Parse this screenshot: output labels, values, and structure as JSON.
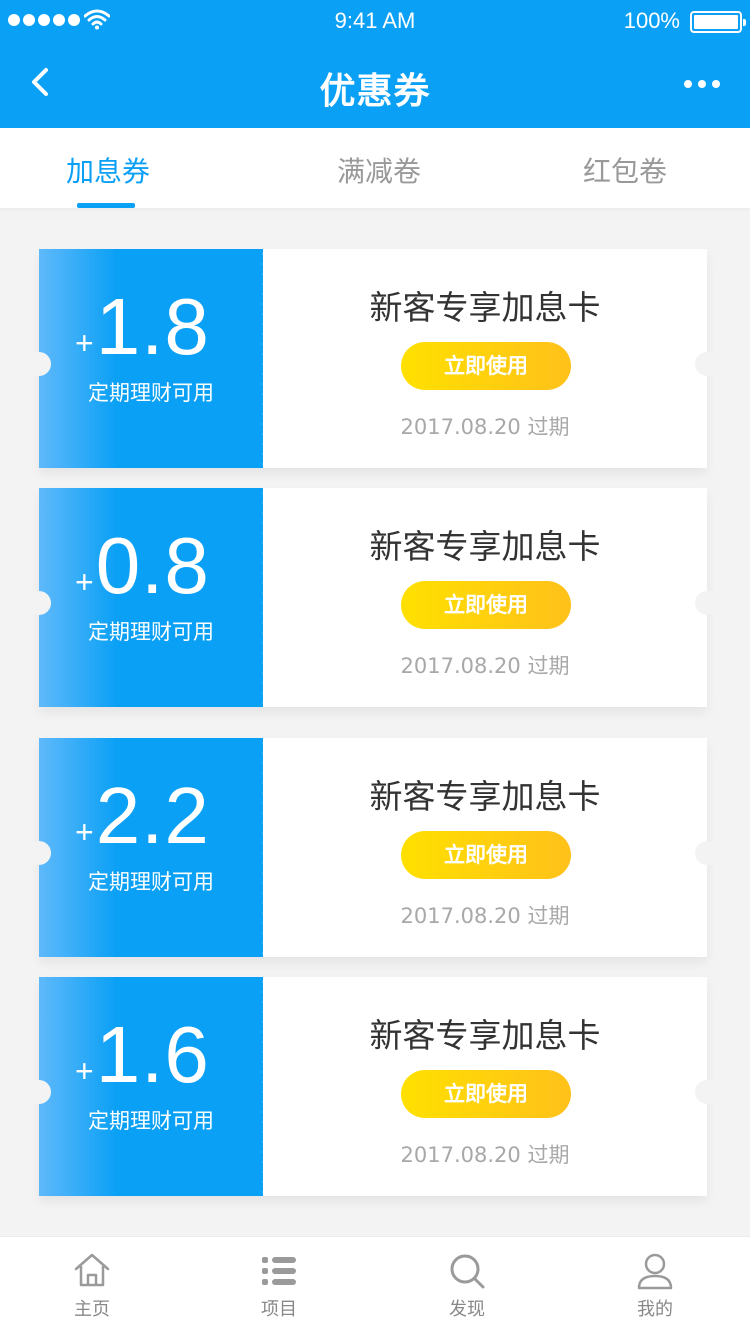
{
  "status_bar": {
    "time": "9:41 AM",
    "battery": "100%"
  },
  "nav": {
    "title": "优惠券",
    "back_icon": "chevron-left-icon",
    "more_icon": "more-dots-icon"
  },
  "tabs": [
    {
      "label": "加息券",
      "active": true
    },
    {
      "label": "满减卷",
      "active": false
    },
    {
      "label": "红包卷",
      "active": false
    }
  ],
  "coupons": [
    {
      "plus": "+",
      "value": "1.8",
      "usage": "定期理财可用",
      "title": "新客专享加息卡",
      "button": "立即使用",
      "expire": "2017.08.20 过期"
    },
    {
      "plus": "+",
      "value": "0.8",
      "usage": "定期理财可用",
      "title": "新客专享加息卡",
      "button": "立即使用",
      "expire": "2017.08.20 过期"
    },
    {
      "plus": "+",
      "value": "2.2",
      "usage": "定期理财可用",
      "title": "新客专享加息卡",
      "button": "立即使用",
      "expire": "2017.08.20 过期"
    },
    {
      "plus": "+",
      "value": "1.6",
      "usage": "定期理财可用",
      "title": "新客专享加息卡",
      "button": "立即使用",
      "expire": "2017.08.20 过期"
    }
  ],
  "tabbar": [
    {
      "label": "主页",
      "icon": "home-icon"
    },
    {
      "label": "项目",
      "icon": "list-icon"
    },
    {
      "label": "发现",
      "icon": "search-icon"
    },
    {
      "label": "我的",
      "icon": "user-icon"
    }
  ],
  "colors": {
    "primary": "#0aa0f5",
    "button": "#ffc11a",
    "background": "#f3f3f3"
  }
}
